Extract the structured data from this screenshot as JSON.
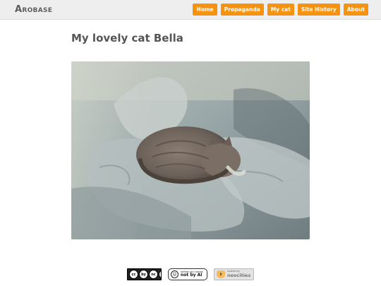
{
  "site": {
    "brand": "Arobase"
  },
  "nav": {
    "items": [
      {
        "label": "Home"
      },
      {
        "label": "Propaganda"
      },
      {
        "label": "My cat"
      },
      {
        "label": "Site History"
      },
      {
        "label": "About"
      }
    ]
  },
  "page": {
    "title": "My lovely cat Bella"
  },
  "photo": {
    "description": "Cat Bella curled up asleep on rumpled bed sheets"
  },
  "footer": {
    "cc_badge": {
      "parts": [
        "cc",
        "by",
        "nc",
        "sa"
      ]
    },
    "ai_badge": {
      "small": "written by human",
      "big": "not by AI"
    },
    "neocities_badge": {
      "small": "hosted by",
      "big": "neocities"
    }
  },
  "colors": {
    "accent": "#f5920f",
    "topbar": "#eeeeee",
    "title": "#555555"
  }
}
